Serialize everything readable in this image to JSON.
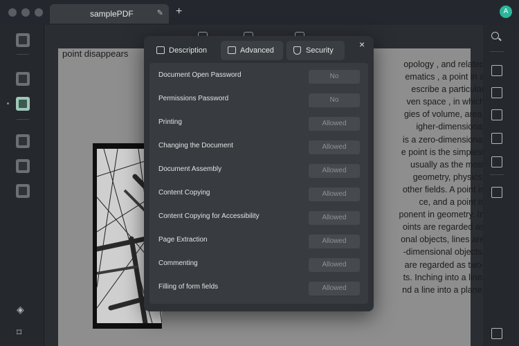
{
  "tab": {
    "title": "samplePDF"
  },
  "avatar": {
    "initial": "A"
  },
  "document": {
    "left_fragment": "point  disappears",
    "right_lines": [
      "opology , and related",
      "ematics , a point in a",
      "escribe a particular",
      "ven  space , in which",
      "gies of volume, area,",
      "igher-dimensional",
      "is a zero-dimensional",
      "e point is the simplest",
      "usually  as the most",
      " geometry, physics,",
      "other fields. A point is",
      "ce, and a point is",
      "ponent in geometry. In",
      "oints are regarded as",
      "onal objects, lines are",
      "-dimensional objects,",
      " are regarded as two-",
      "ts. Inching into a line,",
      "nd a line into a plane."
    ]
  },
  "modal": {
    "tabs": [
      {
        "label": "Description"
      },
      {
        "label": "Advanced"
      },
      {
        "label": "Security"
      }
    ],
    "close_label": "×",
    "permissions": [
      {
        "label": "Document Open Password",
        "value": "No"
      },
      {
        "label": "Permissions Password",
        "value": "No"
      },
      {
        "label": "Printing",
        "value": "Allowed"
      },
      {
        "label": "Changing the Document",
        "value": "Allowed"
      },
      {
        "label": "Document Assembly",
        "value": "Allowed"
      },
      {
        "label": "Content Copying",
        "value": "Allowed"
      },
      {
        "label": "Content Copying for Accessibility",
        "value": "Allowed"
      },
      {
        "label": "Page Extraction",
        "value": "Allowed"
      },
      {
        "label": "Commenting",
        "value": "Allowed"
      },
      {
        "label": "Filling of form fields",
        "value": "Allowed"
      }
    ]
  },
  "icons": {
    "left_sidebar": [
      "reader-icon",
      "highlight-icon",
      "edit-icon",
      "organize-icon",
      "crop-icon",
      "watermark-icon",
      "layers-icon",
      "bookmark-icon"
    ],
    "right_sidebar": [
      "search-icon",
      "ocr-icon",
      "convert-icon",
      "protect-icon",
      "share-icon",
      "email-icon",
      "save-icon",
      "comment-icon"
    ]
  }
}
